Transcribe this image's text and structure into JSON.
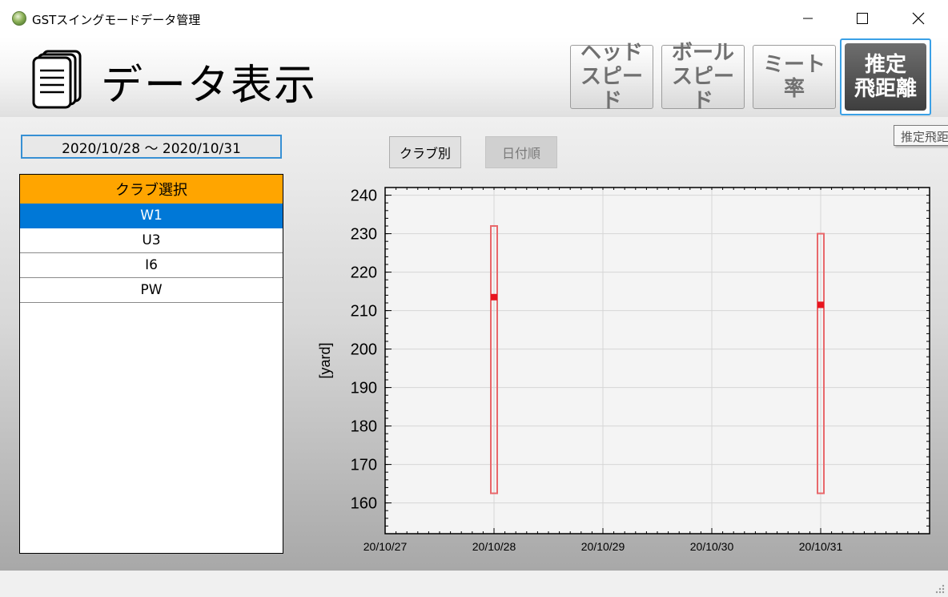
{
  "window": {
    "title": "GSTスイングモードデータ管理"
  },
  "header": {
    "title": "データ表示",
    "nav": [
      {
        "label": "ヘッド\nスピード",
        "active": false
      },
      {
        "label": "ボール\nスピード",
        "active": false
      },
      {
        "label": "ミート率",
        "active": false
      },
      {
        "label": "推定\n飛距離",
        "active": true
      }
    ],
    "tooltip": "推定飛距離"
  },
  "filters": {
    "date_range": "2020/10/28 ～ 2020/10/31",
    "sort_club": "クラブ別",
    "sort_date": "日付順"
  },
  "club_panel": {
    "header": "クラブ選択",
    "items": [
      {
        "label": "W1",
        "selected": true
      },
      {
        "label": "U3",
        "selected": false
      },
      {
        "label": "I6",
        "selected": false
      },
      {
        "label": "PW",
        "selected": false
      }
    ]
  },
  "colors": {
    "accent": "#0078d7",
    "header_orange": "#ffa500",
    "range_bar": "#e8686b",
    "mean_marker": "#e8141e"
  },
  "chart_data": {
    "type": "range",
    "ylabel": "[yard]",
    "ylim": [
      152,
      242
    ],
    "yticks": [
      160,
      170,
      180,
      190,
      200,
      210,
      220,
      230,
      240
    ],
    "xticks": [
      "20/10/27",
      "20/10/28",
      "20/10/29",
      "20/10/30",
      "20/10/31"
    ],
    "xrange": [
      0,
      5
    ],
    "grid": true,
    "series": [
      {
        "x": "20/10/28",
        "min": 162.5,
        "max": 232,
        "mean": 213.5
      },
      {
        "x": "20/10/31",
        "min": 162.5,
        "max": 230,
        "mean": 211.5
      }
    ]
  }
}
